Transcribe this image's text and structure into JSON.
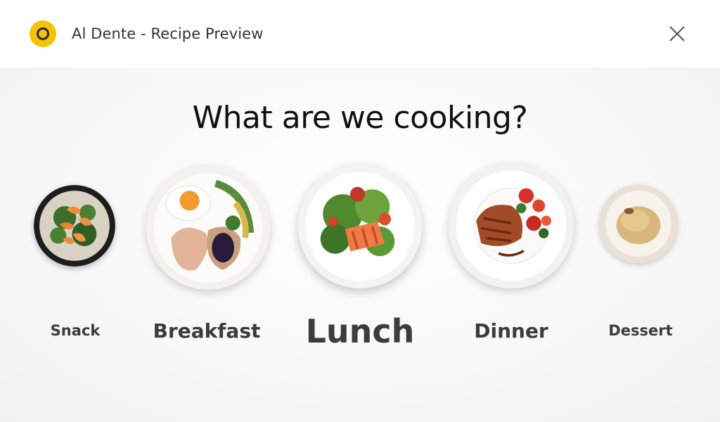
{
  "window": {
    "title": "Al Dente - Recipe Preview",
    "accent_color": "#f4c400",
    "logo_icon": "ring-logo-icon",
    "close_icon": "close-icon"
  },
  "main": {
    "heading": "What are we cooking?",
    "selected": "Lunch",
    "categories": [
      {
        "label": "Snack",
        "image": "shrimp-salad-bowl"
      },
      {
        "label": "Breakfast",
        "image": "fried-egg-toast-plate"
      },
      {
        "label": "Lunch",
        "image": "salmon-salad-plate"
      },
      {
        "label": "Dinner",
        "image": "steak-tomato-plate"
      },
      {
        "label": "Dessert",
        "image": "ice-cream-bowl"
      }
    ]
  }
}
